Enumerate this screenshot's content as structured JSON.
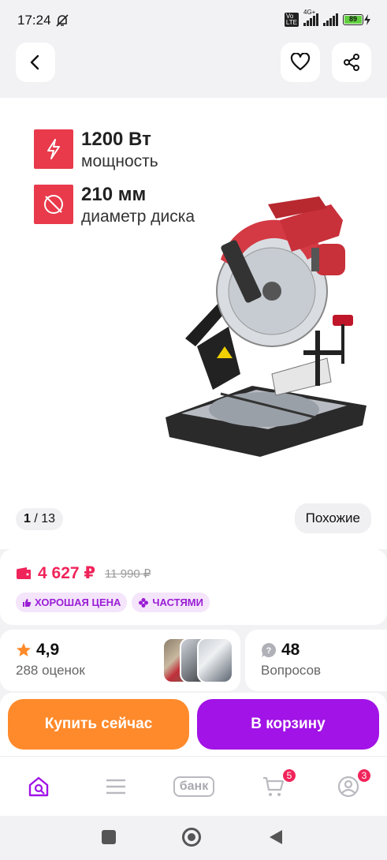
{
  "status": {
    "time": "17:24",
    "battery": "89",
    "network": "4G+"
  },
  "spec1": {
    "value": "1200 Вт",
    "label": "мощность"
  },
  "spec2": {
    "value": "210 мм",
    "label": "диаметр диска"
  },
  "gallery": {
    "current": "1",
    "total": "/ 13",
    "similar_label": "Похожие"
  },
  "price": {
    "current": "4 627 ₽",
    "old": "11 990 ₽",
    "badge_good": "ХОРОШАЯ ЦЕНА",
    "badge_parts": "ЧАСТЯМИ"
  },
  "rating": {
    "value": "4,9",
    "count": "288 оценок"
  },
  "questions": {
    "count": "48",
    "label": "Вопросов"
  },
  "actions": {
    "buy_now": "Купить сейчас",
    "add_to_cart": "В корзину"
  },
  "tabs": {
    "bank": "банк",
    "cart_badge": "5",
    "profile_badge": "3"
  },
  "colors": {
    "accent": "#a113e6",
    "buy": "#ff8a2b",
    "price": "#f0245a",
    "spec": "#e83a4b"
  }
}
